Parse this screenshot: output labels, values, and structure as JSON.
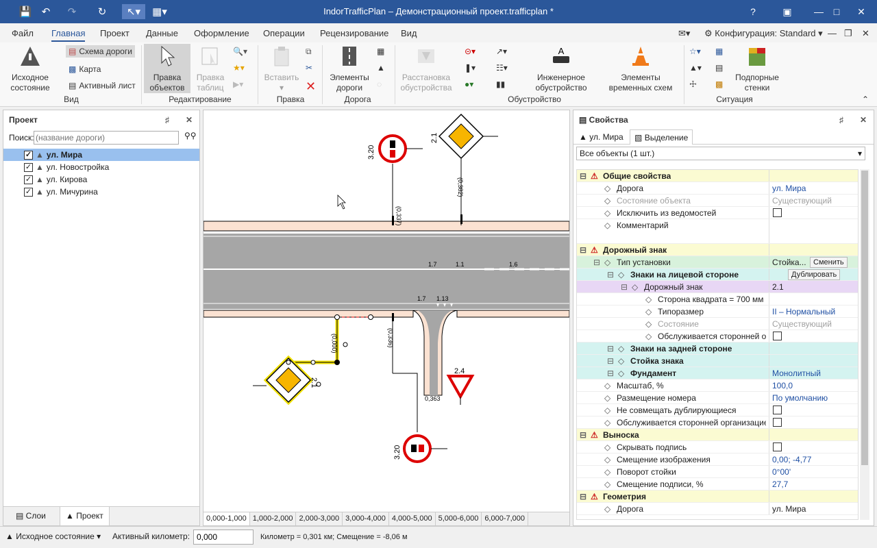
{
  "app": {
    "title": "IndorTrafficPlan – Демонстрационный проект.trafficplan *"
  },
  "menu": [
    "Файл",
    "Главная",
    "Проект",
    "Данные",
    "Оформление",
    "Операции",
    "Рецензирование",
    "Вид"
  ],
  "config": {
    "label": "Конфигурация: Standard"
  },
  "ribbon": {
    "initial_state": "Исходное\nсостояние",
    "road_scheme": "Схема дороги",
    "map": "Карта",
    "active_sheet": "Активный лист",
    "group_view": "Вид",
    "edit_objects": "Правка\nобъектов",
    "edit_tables": "Правка\nтаблиц",
    "group_editing": "Редактирование",
    "paste": "Вставить",
    "group_edit": "Правка",
    "road_elements": "Элементы\nдороги",
    "group_road": "Дорога",
    "arrange": "Расстановка\nобустройства",
    "engineering": "Инженерное\nобустройство",
    "temp_schemes": "Элементы\nвременных схем",
    "group_arrangement": "Обустройство",
    "retaining_walls": "Подпорные\nстенки",
    "group_situation": "Ситуация"
  },
  "project": {
    "title": "Проект",
    "search_label": "Поиск:",
    "search_placeholder": "(название дороги)",
    "roads": [
      {
        "name": "ул. Мира",
        "checked": true,
        "selected": true
      },
      {
        "name": "ул. Новостройка",
        "checked": true
      },
      {
        "name": "ул. Кирова",
        "checked": true
      },
      {
        "name": "ул. Мичурина",
        "checked": true
      }
    ],
    "tab_layers": "Слои",
    "tab_project": "Проект"
  },
  "canvas": {
    "labels": {
      "s320a": "3.20",
      "s21a": "2.1",
      "d0337": "(0,337)",
      "d0382": "(0,382)",
      "m17a": "1.7",
      "m11": "1.1",
      "m16": "1.6",
      "m17b": "1.7",
      "m113": "1.13",
      "d0336": "(0,336)",
      "d0000": "(0,000)",
      "s24": "2.4",
      "s21b": "2.1",
      "d0363": "0,363",
      "s320b": "3.20"
    },
    "km_tabs": [
      "0,000-1,000",
      "1,000-2,000",
      "2,000-3,000",
      "3,000-4,000",
      "4,000-5,000",
      "5,000-6,000",
      "6,000-7,000"
    ]
  },
  "props": {
    "title": "Свойства",
    "tab_road": "ул. Мира",
    "tab_sel": "Выделение",
    "filter": "Все объекты (1 шт.)",
    "rows": [
      {
        "n": "Общие свойства",
        "v": "",
        "lvl": 0,
        "cls": "secthdr"
      },
      {
        "n": "Дорога",
        "v": "ул. Мира",
        "lvl": 1,
        "vc": "vbl"
      },
      {
        "n": "Состояние объекта",
        "v": "Существующий",
        "lvl": 1,
        "nc": "gry",
        "vc": "gry"
      },
      {
        "n": "Исключить из ведомостей",
        "v": "",
        "lvl": 1,
        "cb": true
      },
      {
        "n": "Комментарий",
        "v": "",
        "lvl": 1,
        "tall": true
      },
      {
        "n": "Дорожный знак",
        "v": "",
        "lvl": 0,
        "cls": "secthdr"
      },
      {
        "n": "Тип установки",
        "v": "Стойка...",
        "lvl": 1,
        "cls": "grn",
        "btn": "Сменить"
      },
      {
        "n": "Знаки на лицевой стороне",
        "v": "",
        "lvl": 2,
        "cls": "sub",
        "bold": true,
        "btn": "Дублировать"
      },
      {
        "n": "Дорожный знак",
        "v": "2.1",
        "lvl": 3,
        "cls": "lav"
      },
      {
        "n": "Сторона квадрата = 700 мм",
        "v": "",
        "lvl": 4
      },
      {
        "n": "Типоразмер",
        "v": "II – Нормальный",
        "lvl": 4,
        "vc": "vbl"
      },
      {
        "n": "Состояние",
        "v": "Существующий",
        "lvl": 4,
        "nc": "gry",
        "vc": "gry"
      },
      {
        "n": "Обслуживается сторонней организацией",
        "v": "",
        "lvl": 4,
        "cb": true
      },
      {
        "n": "Знаки на задней стороне",
        "v": "",
        "lvl": 2,
        "cls": "sub",
        "bold": true
      },
      {
        "n": "Стойка знака",
        "v": "",
        "lvl": 2,
        "cls": "sub",
        "bold": true
      },
      {
        "n": "Фундамент",
        "v": "Монолитный",
        "lvl": 2,
        "cls": "sub",
        "bold": true,
        "vc": "vbl"
      },
      {
        "n": "Масштаб, %",
        "v": "100,0",
        "lvl": 1,
        "vc": "vbl"
      },
      {
        "n": "Размещение номера",
        "v": "По умолчанию",
        "lvl": 1,
        "vc": "vbl"
      },
      {
        "n": "Не совмещать дублирующиеся",
        "v": "",
        "lvl": 1,
        "cb": true
      },
      {
        "n": "Обслуживается сторонней организацией",
        "v": "",
        "lvl": 1,
        "cb": true
      },
      {
        "n": "Выноска",
        "v": "",
        "lvl": 0,
        "cls": "secthdr"
      },
      {
        "n": "Скрывать подпись",
        "v": "",
        "lvl": 1,
        "cb": true
      },
      {
        "n": "Смещение изображения",
        "v": "0,00; -4,77",
        "lvl": 1,
        "vc": "vbl"
      },
      {
        "n": "Поворот стойки",
        "v": "0°00'",
        "lvl": 1,
        "vc": "vbl"
      },
      {
        "n": "Смещение подписи, %",
        "v": "27,7",
        "lvl": 1,
        "vc": "vbl"
      },
      {
        "n": "Геометрия",
        "v": "",
        "lvl": 0,
        "cls": "secthdr"
      },
      {
        "n": "Дорога",
        "v": "ул. Мира",
        "lvl": 1
      }
    ]
  },
  "status": {
    "state": "Исходное состояние",
    "km_label": "Активный километр:",
    "km_value": "0,000",
    "info": "Километр = 0,301 км; Смещение = -8,06 м"
  }
}
